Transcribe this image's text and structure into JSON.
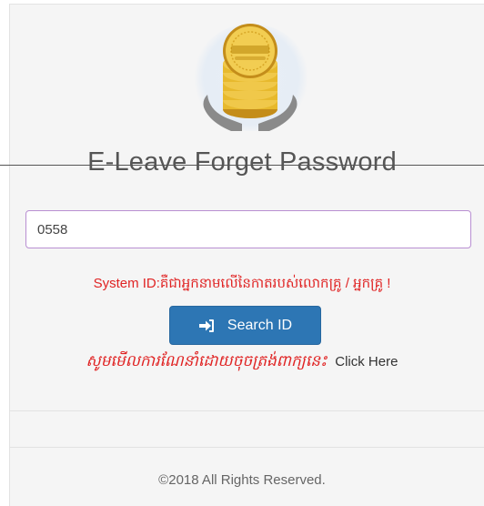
{
  "logo": {
    "icon": "coin-stack-hands-logo",
    "colors": {
      "coin": "#e7b92d",
      "coin_edge": "#c48d1a",
      "hands": "#8a8a8a"
    }
  },
  "title": "E-Leave Forget Password",
  "form": {
    "system_id_value": "0558",
    "system_note": "System ID:គឺជាអ្នកនាមលើនៃកាតរបស់លោកគ្រូ / អ្នកគ្រូ !",
    "search_button_label": "Search ID",
    "search_button_icon": "sign-in-icon",
    "guide_text": "សូមមើលការណែនាំដោយចុចត្រង់ពាក្យនេះ",
    "click_here_label": "Click Here"
  },
  "footer": {
    "copyright": "©2018 All Rights Reserved."
  },
  "colors": {
    "accent_button": "#2d76b4",
    "note_red": "#e02323",
    "input_border": "#b98fd2",
    "panel_bg": "#f5f5f5"
  }
}
